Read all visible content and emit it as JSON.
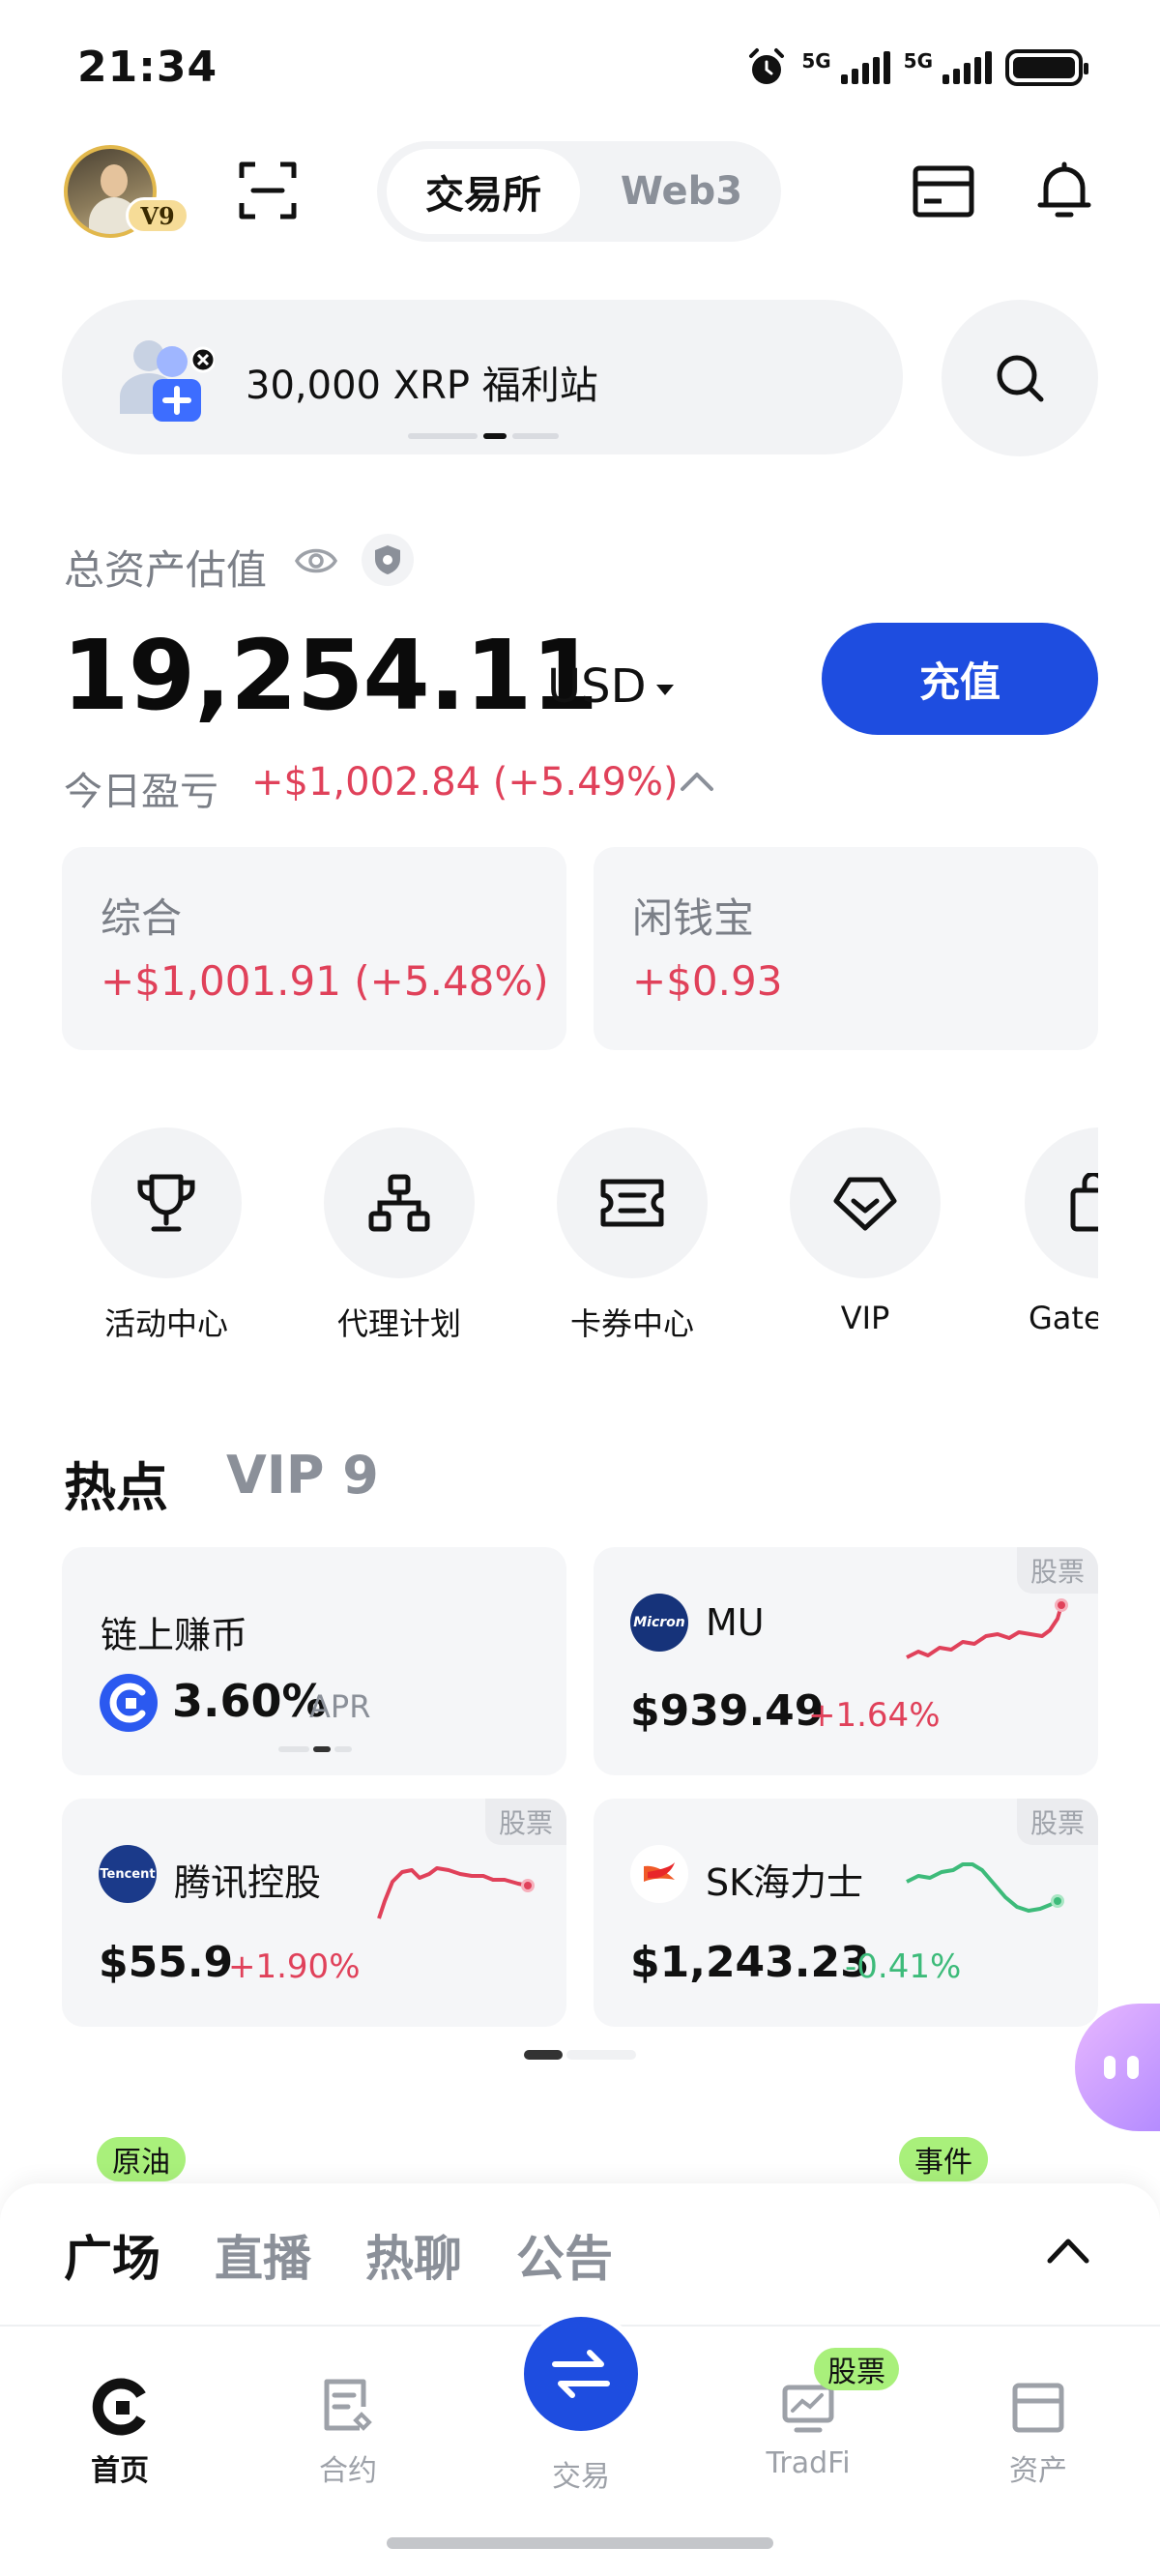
{
  "status_bar": {
    "time": "21:34",
    "network1": "5G",
    "network2": "5G"
  },
  "header": {
    "vip_badge": "V9",
    "segments": [
      "交易所",
      "Web3"
    ],
    "active_segment": "交易所"
  },
  "banner": {
    "text": "30,000 XRP 福利站"
  },
  "assets": {
    "label": "总资产估值",
    "balance": "19,254.11",
    "currency": "USD",
    "deposit_label": "充值",
    "pnl_label": "今日盈亏",
    "pnl_value": "+$1,002.84 (+5.49%)",
    "cards": [
      {
        "title": "综合",
        "value": "+$1,001.91 (+5.48%)"
      },
      {
        "title": "闲钱宝",
        "value": "+$0.93"
      }
    ]
  },
  "quick_actions": [
    {
      "label": "活动中心",
      "icon": "trophy-icon"
    },
    {
      "label": "代理计划",
      "icon": "org-chart-icon"
    },
    {
      "label": "卡券中心",
      "icon": "ticket-icon"
    },
    {
      "label": "VIP",
      "icon": "diamond-icon"
    },
    {
      "label": "Gate",
      "icon": "bag-icon"
    }
  ],
  "hot": {
    "title": "热点",
    "subtitle": "VIP 9",
    "stock_tag": "股票",
    "cards": [
      {
        "name": "链上赚币",
        "value": "3.60%",
        "unit": "APR"
      },
      {
        "name": "MU",
        "logo": "Micron",
        "price": "$939.49",
        "change": "+1.64%"
      },
      {
        "name": "腾讯控股",
        "logo": "Tencent",
        "price": "$55.9",
        "change": "+1.90%"
      },
      {
        "name": "SK海力士",
        "price": "$1,243.23",
        "change": "-0.41%"
      }
    ],
    "pills": [
      "原油",
      "事件"
    ]
  },
  "feed_tabs": [
    "广场",
    "直播",
    "热聊",
    "公告"
  ],
  "tab_bar": {
    "items": [
      "首页",
      "合约",
      "交易",
      "TradFi",
      "资产"
    ],
    "active": "首页",
    "tradfi_badge": "股票"
  },
  "colors": {
    "accent": "#1e4de0",
    "up": "#e0415a",
    "down": "#3dbb7a",
    "pill": "#a9f07b"
  }
}
